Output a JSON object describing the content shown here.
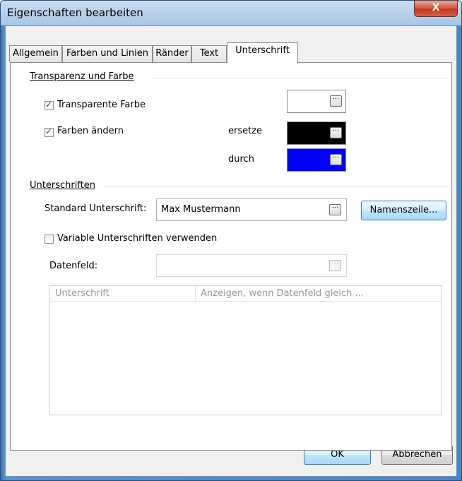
{
  "window": {
    "title": "Eigenschaften bearbeiten",
    "close_label": "X"
  },
  "tabs": [
    {
      "label": "Allgemein"
    },
    {
      "label": "Farben und Linien"
    },
    {
      "label": "Ränder"
    },
    {
      "label": "Text"
    },
    {
      "label": "Unterschrift"
    }
  ],
  "active_tab": "Unterschrift",
  "transparency": {
    "section_label": "Transparenz und Farbe",
    "transparent_color_label": "Transparente Farbe",
    "transparent_color_checked": true,
    "transparent_color_value": "#ffffff",
    "change_colors_label": "Farben ändern",
    "change_colors_checked": true,
    "replace_label": "ersetze",
    "replace_color": "#000000",
    "with_label": "durch",
    "with_color": "#0000ff"
  },
  "signatures": {
    "section_label": "Unterschriften",
    "standard_label": "Standard Unterschrift:",
    "standard_value": "Max Mustermann",
    "namenszeile_button": "Namenszeile...",
    "variable_label": "Variable Unterschriften verwenden",
    "variable_checked": false,
    "datafield_label": "Datenfeld:",
    "datafield_value": "",
    "list_columns": [
      "Unterschrift",
      "Anzeigen, wenn Datenfeld gleich ..."
    ]
  },
  "buttons": {
    "ok": "OK",
    "cancel": "Abbrechen"
  },
  "check_glyph": "✓",
  "dots_glyph": "···"
}
